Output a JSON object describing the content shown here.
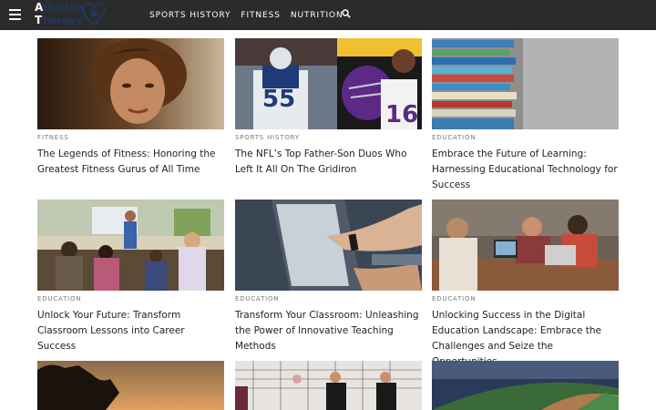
{
  "header": {
    "logo_letters": "A\nT",
    "logo_words": "thletics\nherapy",
    "nav": [
      "SPORTS HISTORY",
      "FITNESS",
      "NUTRITION"
    ]
  },
  "cards": [
    {
      "category": "FITNESS",
      "title": "The Legends of Fitness: Honoring the Greatest Fitness Gurus of All Time"
    },
    {
      "category": "SPORTS HISTORY",
      "title": "The NFL’s Top Father-Son Duos Who Left It All On The Gridiron"
    },
    {
      "category": "EDUCATION",
      "title": "Embrace the Future of Learning: Harnessing Educational Technology for Success"
    },
    {
      "category": "EDUCATION",
      "title": "Unlock Your Future: Transform Classroom Lessons into Career Success"
    },
    {
      "category": "EDUCATION",
      "title": "Transform Your Classroom: Unleashing the Power of Innovative Teaching Methods"
    },
    {
      "category": "EDUCATION",
      "title": "Unlocking Success in the Digital Education Landscape: Embrace the Challenges and Seize the Opportunities"
    }
  ],
  "colors": {
    "header_bg": "#2b2b2b",
    "logo_blue": "#1e3a5f",
    "category_gray": "#7a7a7a"
  }
}
